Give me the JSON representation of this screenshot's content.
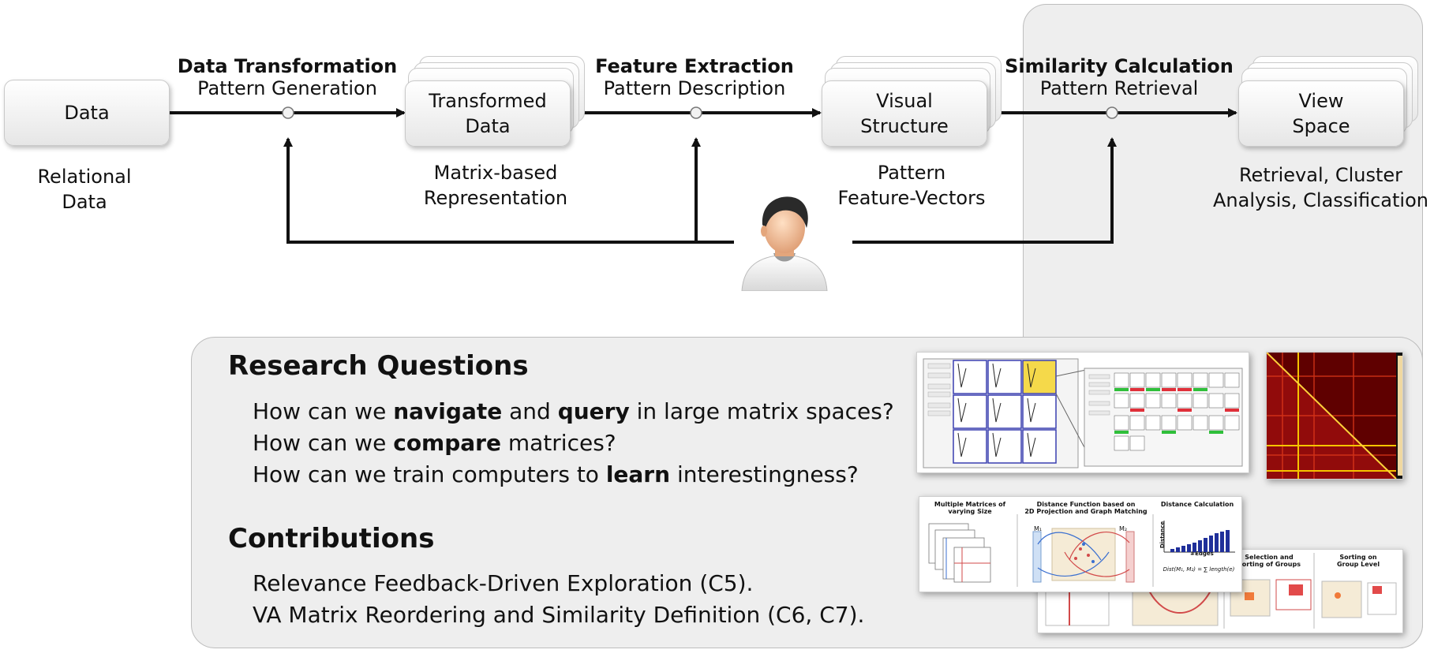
{
  "nodes": {
    "data": "Data",
    "transformed": "Transformed\nData",
    "visual": "Visual\nStructure",
    "view": "View\nSpace"
  },
  "captions": {
    "data": "Relational\nData",
    "transformed": "Matrix-based\nRepresentation",
    "visual": "Pattern\nFeature-Vectors",
    "view": "Retrieval, Cluster\nAnalysis, Classification"
  },
  "steps": [
    {
      "title": "Data Transformation",
      "subtitle": "Pattern Generation"
    },
    {
      "title": "Feature Extraction",
      "subtitle": "Pattern Description"
    },
    {
      "title": "Similarity Calculation",
      "subtitle": "Pattern Retrieval"
    }
  ],
  "research": {
    "heading": "Research Questions",
    "q1": {
      "a": "How can we ",
      "b1": "navigate",
      "c": " and ",
      "b2": "query",
      "d": " in large matrix spaces?"
    },
    "q2": {
      "a": "How can we ",
      "b1": "compare",
      "d": " matrices?"
    },
    "q3": {
      "a": "How can we train computers to ",
      "b1": "learn",
      "d": " interestingness?"
    }
  },
  "contributions": {
    "heading": "Contributions",
    "items": [
      "Relevance Feedback-Driven Exploration (C5).",
      "VA Matrix Reordering and Similarity Definition (C6, C7)."
    ]
  },
  "thumbnails": {
    "panel_a": {
      "col1": "Multiple Matrices of varying Size",
      "col2": "Distance Function based on\n2D Projection and Graph Matching",
      "col3": "Distance Calculation",
      "axis_y": "Distance",
      "axis_x": "#Edges",
      "m1": "M₁",
      "m2": "M₂",
      "formula": "Dist(M₁, M₂) = ∑ length(e)"
    },
    "panel_b": {
      "col1": "Selection and\nSorting of Groups",
      "col2": "Sorting on\nGroup Level"
    }
  },
  "colors": {
    "panel_bg": "#eeeeee",
    "heatmap": "#8b0000",
    "highlight": "#f5d94a",
    "grid_blue": "#3a3fb0"
  }
}
